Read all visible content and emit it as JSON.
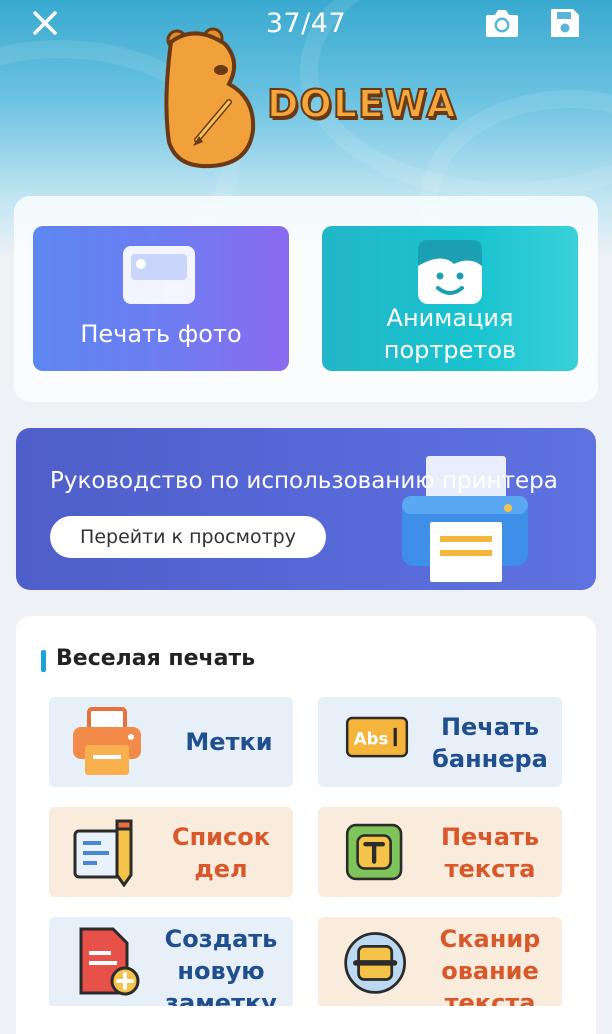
{
  "topbar": {
    "counter": "37/47",
    "close_icon": "close-icon",
    "camera_icon": "camera-icon",
    "save_icon": "save-icon"
  },
  "brand": {
    "logo_text": "DOLEWA"
  },
  "features": {
    "print_photo": "Печать фото",
    "portrait_animation_line1": "Анимация",
    "portrait_animation_line2": "портретов"
  },
  "banner": {
    "title": "Руководство по использованию принтера",
    "button": "Перейти к просмотру"
  },
  "fun_print": {
    "title": "Веселая печать",
    "items": [
      {
        "line1": "Метки",
        "line2": "",
        "icon": "label-printer-icon"
      },
      {
        "line1": "Печать",
        "line2": "баннера",
        "icon": "abs-banner-icon"
      },
      {
        "line1": "Список",
        "line2": "дел",
        "icon": "todo-list-icon"
      },
      {
        "line1": "Печать",
        "line2": "текста",
        "icon": "text-t-icon"
      },
      {
        "line1": "Создать",
        "line2": "новую",
        "line3": "заметку",
        "icon": "new-note-icon"
      },
      {
        "line1": "Сканир",
        "line2": "ование",
        "line3": "текста",
        "icon": "scan-text-icon"
      }
    ]
  },
  "colors": {
    "accent": "#1aa5d8",
    "blue_tile_text": "#1f4f8f",
    "orange_tile_text": "#d8582a"
  }
}
